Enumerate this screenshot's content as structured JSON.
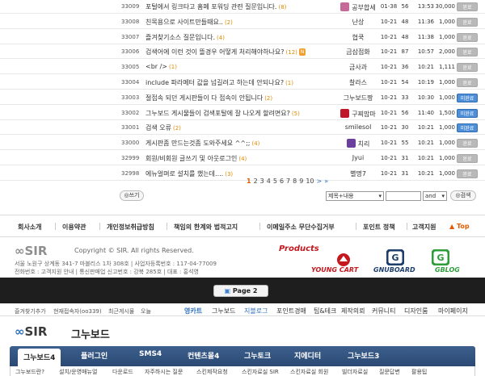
{
  "board": {
    "rows": [
      {
        "num": "33009",
        "subject": "포털에서 링크타고 홈페 포워딩 관련 질문입니다.",
        "comments": "(8)",
        "badge": "",
        "name": "공부합세",
        "icon": "#c66a9a",
        "date": "01-38",
        "cnt": "56",
        "hits": "13:53",
        "views": "30,000",
        "status": "완료",
        "open": false
      },
      {
        "num": "33008",
        "subject": "친목용으로 사이트만들때요..",
        "comments": "(2)",
        "badge": "",
        "name": "난상",
        "icon": "",
        "date": "10-21",
        "cnt": "48",
        "hits": "11:36",
        "views": "1,000",
        "status": "완료",
        "open": false
      },
      {
        "num": "33007",
        "subject": "즐겨찾기소스 질문입니다.",
        "comments": "(4)",
        "badge": "",
        "name": "협쿡",
        "icon": "",
        "date": "10-21",
        "cnt": "48",
        "hits": "11:38",
        "views": "1,000",
        "status": "완료",
        "open": false
      },
      {
        "num": "33006",
        "subject": "검색어에 이런 것이 뜰경우 어떻게 처리해야하나요?",
        "comments": "(12)",
        "badge": "N",
        "name": "금삼점화",
        "icon": "",
        "date": "10-21",
        "cnt": "87",
        "hits": "10:57",
        "views": "2,000",
        "status": "완료",
        "open": false
      },
      {
        "num": "33005",
        "subject": "<br />",
        "comments": "(1)",
        "badge": "",
        "name": "금사과",
        "icon": "",
        "date": "10-21",
        "cnt": "36",
        "hits": "10:21",
        "views": "1,111",
        "status": "완료",
        "open": false
      },
      {
        "num": "33004",
        "subject": "include 파라메터 값을 넘길려고 하는데 안되나요?",
        "comments": "(1)",
        "badge": "",
        "name": "찰라스",
        "icon": "",
        "date": "10-21",
        "cnt": "54",
        "hits": "10:19",
        "views": "1,000",
        "status": "완료",
        "open": false
      },
      {
        "num": "33003",
        "subject": "절접속 되던 게시판들이 다 접속이 안됩니다",
        "comments": "(2)",
        "badge": "",
        "name": "그누보드짱",
        "icon": "",
        "date": "10-21",
        "cnt": "33",
        "hits": "10:30",
        "views": "1,000",
        "status": "미완료",
        "open": true
      },
      {
        "num": "33002",
        "subject": "그누보드 게시물들이 검색포탈에 잘 나오게 할려면요?",
        "comments": "(5)",
        "badge": "",
        "name": "구찌맘마",
        "icon": "#c0162a",
        "date": "10-21",
        "cnt": "56",
        "hits": "11:40",
        "views": "1,500",
        "status": "미완료",
        "open": true
      },
      {
        "num": "33001",
        "subject": "검색 오류",
        "comments": "(2)",
        "badge": "",
        "name": "smilesol",
        "icon": "",
        "date": "10-21",
        "cnt": "30",
        "hits": "10:21",
        "views": "1,000",
        "status": "미완료",
        "open": true
      },
      {
        "num": "33000",
        "subject": "게시판좀 만드는것좀 도와주세요 ^^;;",
        "comments": "(4)",
        "badge": "",
        "name": "치리",
        "icon": "#6a3f9e",
        "date": "10-21",
        "cnt": "55",
        "hits": "10:21",
        "views": "1,000",
        "status": "완료",
        "open": false
      },
      {
        "num": "32999",
        "subject": "회원/비회원 글쓰기 및 아웃로그인",
        "comments": "(4)",
        "badge": "",
        "name": "Jyui",
        "icon": "",
        "date": "10-21",
        "cnt": "31",
        "hits": "10:21",
        "views": "1,000",
        "status": "완료",
        "open": false
      },
      {
        "num": "32998",
        "subject": "에뉴얼며로 설치를 했는데....",
        "comments": "(3)",
        "badge": "",
        "name": "별명7",
        "icon": "",
        "date": "10-21",
        "cnt": "31",
        "hits": "10:21",
        "views": "1,000",
        "status": "완료",
        "open": false
      }
    ]
  },
  "pager": {
    "pages": [
      "1",
      "2",
      "3",
      "4",
      "5",
      "6",
      "7",
      "8",
      "9",
      "10"
    ],
    "current": "1",
    "next": ">",
    "last": "»"
  },
  "write_label": "쓰기",
  "search": {
    "select": "제목+내용",
    "op": "and",
    "button": "검색"
  },
  "footer_links": [
    "회사소개",
    "이용약관",
    "개인정보취급방침",
    "책임의 한계와 법적고지",
    "이메일주소 무단수집거부",
    "포인트 정책",
    "고객지원"
  ],
  "top_label": "▲ Top",
  "footer": {
    "logo": "SIR",
    "copyright": "Copyright © SIR. All rights Reserved.",
    "addr1": "서울 노원구 상계동 341-7 마블리스 1차 308호 | 사업자등록번호 : 117-04-77009",
    "addr2": "전화번호 : 고객지원 안내 | 통신판매업 신고번호 : 강북 285호 | 대표 : 홍석영",
    "products_label": "Products",
    "products": [
      "YOUNG CART",
      "GNUBOARD",
      "GBLOG"
    ]
  },
  "page_pill": "Page 2",
  "topbar": {
    "left": [
      "즐겨찾기추가",
      "현재접속자(oo339)",
      "최근게시물",
      "오늘"
    ],
    "menu": [
      "영카트",
      "그누보드",
      "지블로그",
      "포인트경매",
      "팁&테크",
      "제작의뢰",
      "커뮤니티",
      "디자인룸",
      "마이페이지"
    ]
  },
  "board_title": "그누보드",
  "nav": [
    "그누보드4",
    "플러그인",
    "SMS4",
    "컨텐츠몰4",
    "그누토크",
    "지에디터",
    "그누보드3"
  ],
  "subnav": [
    "그누보드란?",
    "설치/운영매뉴얼",
    "다운로드",
    "자주하시는 질문",
    "스킨제작요청",
    "스킨자료실 SIR",
    "스킨자료실 회원",
    "빌더자료실",
    "질문답변",
    "팔용팁"
  ]
}
